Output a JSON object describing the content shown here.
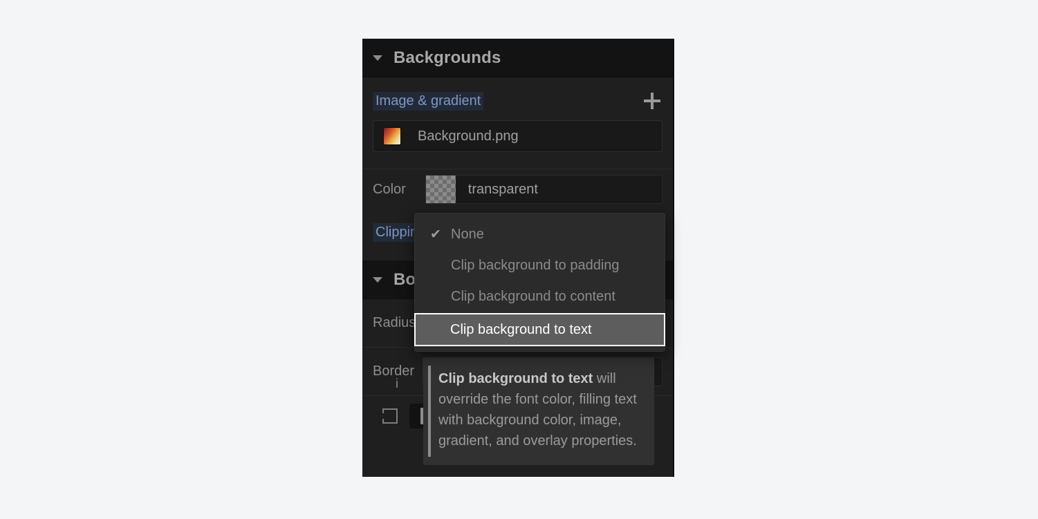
{
  "panel": {
    "backgrounds_section": {
      "title": "Backgrounds",
      "disclosure_icon": "triangle-down-icon",
      "image_gradient_label": "Image & gradient",
      "add_icon": "plus-icon",
      "layers": [
        {
          "name": "Background.png",
          "thumb_icon": "gradient-thumbnail-icon"
        }
      ],
      "color_label": "Color",
      "color_value": "transparent",
      "color_swatch_icon": "transparent-checkerboard-swatch",
      "clipping_label": "Clipping"
    },
    "borders_section": {
      "title": "Bo",
      "disclosure_icon": "triangle-down-icon",
      "radius_label": "Radius",
      "border_label": "Border",
      "units_label": "i",
      "side_all_icon": "border-all-sides-icon",
      "side_left_icon": "border-left-side-icon"
    }
  },
  "clipping_dropdown": {
    "items": [
      {
        "label": "None",
        "checked": true,
        "selected": false
      },
      {
        "label": "Clip background to padding",
        "checked": false,
        "selected": false
      },
      {
        "label": "Clip background to content",
        "checked": false,
        "selected": false
      },
      {
        "label": "Clip background to text",
        "checked": false,
        "selected": true
      }
    ],
    "check_glyph": "✔"
  },
  "tooltip": {
    "bold_lead": "Clip background to text",
    "body": " will override the font color, filling text with background color, image, gradient, and overlay properties."
  },
  "colors": {
    "page_background": "#f4f5f7",
    "panel_background": "#1f1f1f",
    "section_header_background": "#131313",
    "label_highlight_text": "#7e97c4",
    "label_highlight_background": "#222a38",
    "dropdown_background": "#2b2b2b",
    "selected_item_background": "#5d5d5d",
    "selected_item_border": "#ffffff",
    "tooltip_background": "#313131",
    "tooltip_accent": "#8d8d8d"
  }
}
